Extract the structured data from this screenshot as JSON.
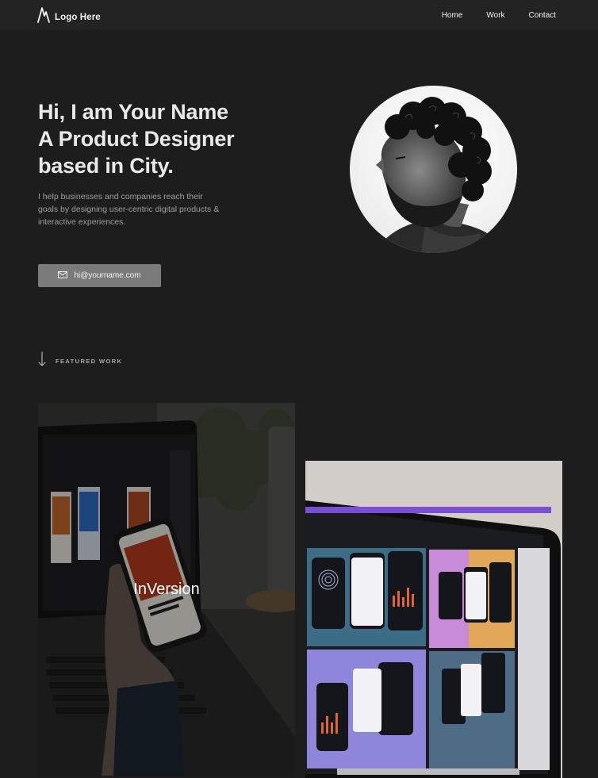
{
  "nav": {
    "logo_text": "Logo Here",
    "links": [
      "Home",
      "Work",
      "Contact"
    ]
  },
  "hero": {
    "title_lines": [
      "Hi, I am Your Name",
      "A Product Designer",
      "based in City."
    ],
    "description": "I help businesses and companies reach their goals by designing user-centric digital products & interactive experiences.",
    "email_label": "hi@yourname.com"
  },
  "featured": {
    "label": "FEATURED WORK",
    "projects": [
      {
        "title": "InVersion"
      },
      {
        "title": ""
      }
    ]
  },
  "colors": {
    "background": "#1d1d1d",
    "nav_background": "#232323",
    "button_background": "#7a7a7a"
  }
}
